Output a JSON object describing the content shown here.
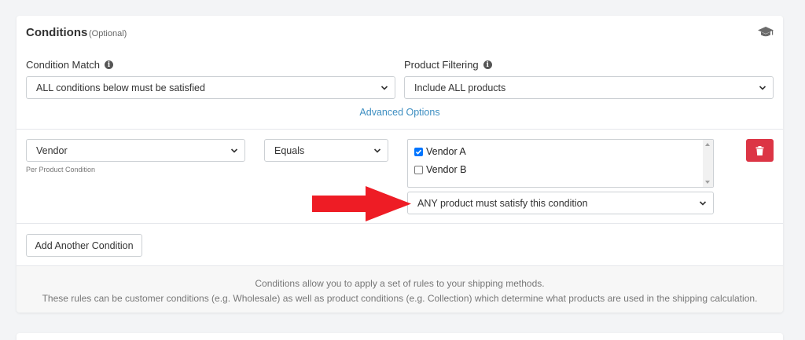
{
  "header": {
    "title": "Conditions",
    "optional": "(Optional)",
    "help_icon": "graduation-cap-icon"
  },
  "condition_match": {
    "label": "Condition Match",
    "value": "ALL conditions below must be satisfied"
  },
  "product_filtering": {
    "label": "Product Filtering",
    "value": "Include ALL products"
  },
  "advanced_options": "Advanced Options",
  "condition_row": {
    "field": "Vendor",
    "field_hint": "Per Product Condition",
    "operator": "Equals",
    "values": [
      {
        "label": "Vendor A",
        "checked": true
      },
      {
        "label": "Vendor B",
        "checked": false
      }
    ],
    "scope": "ANY product must satisfy this condition",
    "delete_icon": "trash-icon"
  },
  "add_button": "Add Another Condition",
  "footer": {
    "line1": "Conditions allow you to apply a set of rules to your shipping methods.",
    "line2": "These rules can be customer conditions (e.g. Wholesale) as well as product conditions (e.g. Collection) which determine what products are used in the shipping calculation."
  },
  "colors": {
    "accent_link": "#3d8ec1",
    "danger": "#dc3545",
    "annotation_arrow": "#ee1c25",
    "checkbox": "#0075ff"
  }
}
